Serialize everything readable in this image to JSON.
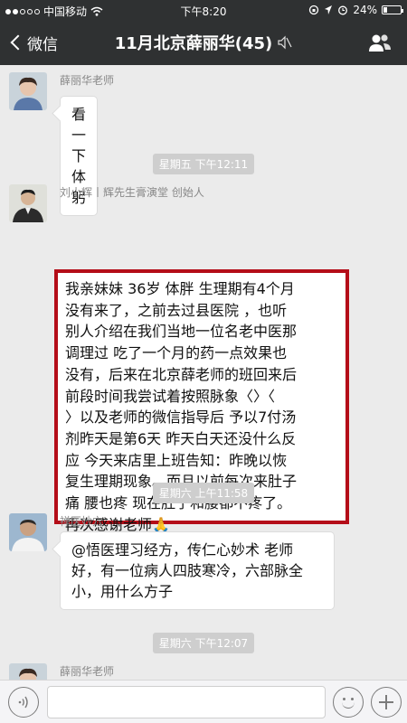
{
  "status_bar": {
    "carrier": "中国移动",
    "time": "下午8:20",
    "battery": "24%",
    "battery_level": 0.24
  },
  "nav": {
    "back_label": "微信",
    "title": "11月北京薛丽华(45)"
  },
  "messages": [
    {
      "sender": "薛丽华老师",
      "text": "看一下体躬"
    },
    {
      "time": "星期五 下午12:11"
    },
    {
      "sender": "刘小辉丨辉先生膏演堂 创始人",
      "lines": [
        "我亲妹妹 36岁 体胖 生理期有4个月",
        "没有来了，之前去过县医院 ，也听",
        "别人介绍在我们当地一位名老中医那",
        "调理过 吃了一个月的药一点效果也",
        "没有，后来在北京薛老师的班回来后",
        " 前段时间我尝试着按照脉象〈〉〈",
        "〉以及老师的微信指导后 予以7付汤",
        "剂昨天是第6天 昨天白天还没什么反",
        "应 今天来店里上班告知：昨晚以恢",
        "复生理期现象。而且以前每次来肚子",
        "痛 腰也疼 现在肚子和腰都不疼了。",
        "再次感谢老师"
      ],
      "emoji": "🙏"
    },
    {
      "time": "星期六 上午11:58"
    },
    {
      "sender": "禅医妙穴",
      "lines": [
        "@悟医理习经方，传仁心妙术 老师",
        "好，有一位病人四肢寒冷，六部脉全",
        "小，用什么方子"
      ]
    },
    {
      "time": "星期六 下午12:07"
    },
    {
      "sender": "薛丽华老师"
    }
  ],
  "input": {
    "placeholder": ""
  },
  "colors": {
    "nav_bg": "#2f3132",
    "chat_bg": "#ebebeb",
    "highlight_border": "#b40d18",
    "time_label_bg": "#cecece"
  }
}
